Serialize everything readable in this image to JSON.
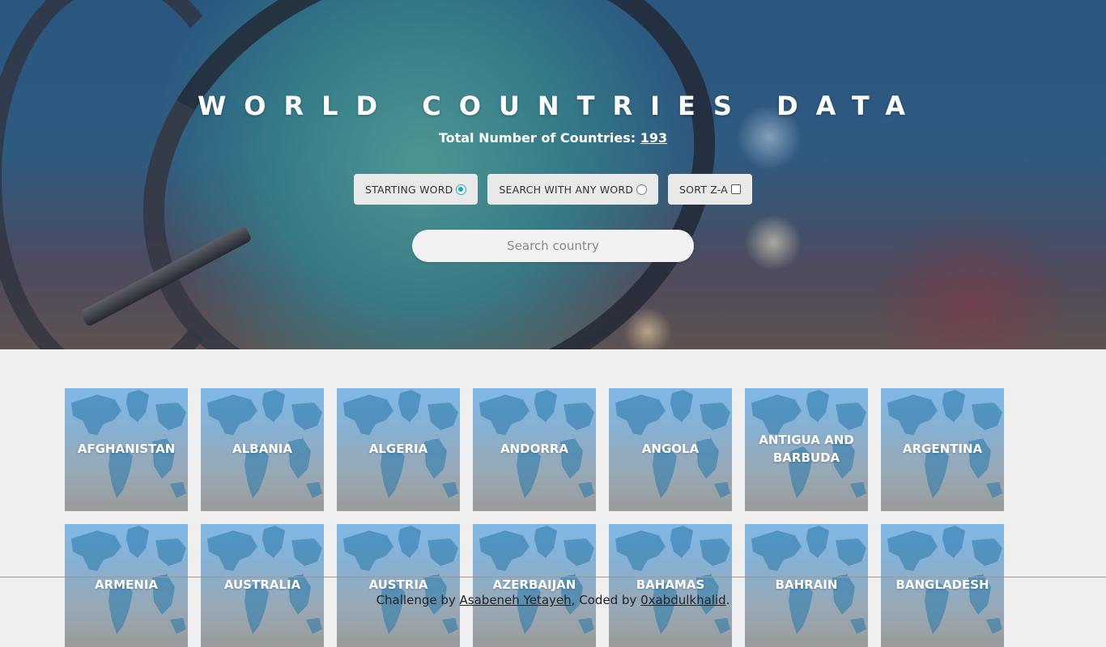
{
  "hero": {
    "title": "WORLD COUNTRIES DATA",
    "subtitle_label": "Total Number of Countries:",
    "total_countries": "193"
  },
  "controls": {
    "starting_word_label": "STARTING WORD",
    "any_word_label": "SEARCH WITH ANY WORD",
    "sort_label": "SORT Z-A",
    "starting_word_selected": true,
    "any_word_selected": false,
    "sort_checked": false
  },
  "search": {
    "placeholder": "Search country",
    "value": ""
  },
  "countries": [
    "AFGHANISTAN",
    "ALBANIA",
    "ALGERIA",
    "ANDORRA",
    "ANGOLA",
    "ANTIGUA AND BARBUDA",
    "ARGENTINA",
    "ARMENIA",
    "AUSTRALIA",
    "AUSTRIA",
    "AZERBAIJAN",
    "BAHAMAS",
    "BAHRAIN",
    "BANGLADESH"
  ],
  "footer": {
    "prefix": "Challenge by",
    "author": "Asabeneh Yetayeh",
    "middle": ", Coded by",
    "coder": "0xabdulkhalid",
    "suffix": "."
  },
  "colors": {
    "accent": "#1aa6c8",
    "page_bg": "#efefef",
    "card_top": "#7fb8e8",
    "card_bottom": "#9b9b9b"
  }
}
